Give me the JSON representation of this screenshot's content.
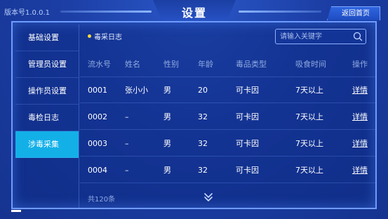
{
  "header": {
    "version": "版本号1.0.0.1",
    "title": "设置",
    "back_label": "返回首页"
  },
  "sidebar": {
    "items": [
      {
        "label": "基础设置"
      },
      {
        "label": "管理员设置"
      },
      {
        "label": "操作员设置"
      },
      {
        "label": "毒检日志"
      },
      {
        "label": "涉毒采集"
      }
    ],
    "active_index": 4
  },
  "main": {
    "section_label": "毒采日志",
    "search": {
      "placeholder": "请输入关键字",
      "value": ""
    },
    "table": {
      "headers": [
        "流水号",
        "姓名",
        "性别",
        "年龄",
        "毒品类型",
        "吸食时间",
        "操作"
      ],
      "rows": [
        [
          "0001",
          "张小小",
          "男",
          "20",
          "可卡因",
          "7天以上",
          "详情"
        ],
        [
          "0002",
          "–",
          "男",
          "32",
          "可卡因",
          "7天以上",
          "详情"
        ],
        [
          "0003",
          "–",
          "男",
          "32",
          "可卡因",
          "7天以上",
          "详情"
        ],
        [
          "0004",
          "–",
          "男",
          "32",
          "可卡因",
          "7天以上",
          "详情"
        ]
      ]
    },
    "total": "共120条"
  },
  "colors": {
    "background": "#1c3fa6",
    "active_tab": "#13b0e8",
    "indicator_dot": "#f3dc3b",
    "panel_border": "#6e9bff"
  },
  "icons": {
    "search": "search-icon",
    "load_more": "chevron-double-down-icon"
  }
}
